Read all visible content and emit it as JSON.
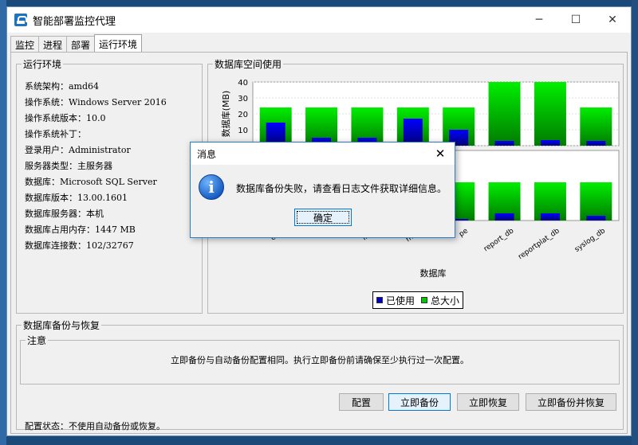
{
  "window": {
    "title": "智能部署监控代理",
    "controls": {
      "minimize": "─",
      "maximize": "☐",
      "close": "✕"
    }
  },
  "tabs": [
    {
      "label": "监控",
      "active": false
    },
    {
      "label": "进程",
      "active": false
    },
    {
      "label": "部署",
      "active": false
    },
    {
      "label": "运行环境",
      "active": true
    }
  ],
  "env": {
    "title": "运行环境",
    "lines": [
      "系统架构：amd64",
      "操作系统：Windows Server 2016",
      "操作系统版本：10.0",
      "操作系统补丁：",
      "登录用户：Administrator",
      "服务器类型：主服务器",
      "数据库：Microsoft SQL Server",
      "数据库版本：13.00.1601",
      "数据库服务器：本机",
      "数据库占用内存：1447 MB",
      "数据库连接数：102/32767"
    ]
  },
  "db_panel": {
    "title": "数据库空间使用"
  },
  "chart_data": {
    "type": "bar",
    "xlabel": "数据库",
    "ylabel": "数据库(MB)",
    "ylim": [
      0,
      40
    ],
    "yticks": [
      "0",
      "10",
      "20",
      "30",
      "40"
    ],
    "categories_visible": [
      "conf",
      "ic",
      "inve",
      "moni",
      "pe",
      "report_db",
      "reportplat_db",
      "syslog_db"
    ],
    "series": [
      {
        "name": "已使用",
        "color": "#0000c8",
        "values": [
          14.5,
          5,
          5,
          17,
          10,
          3,
          3.5,
          3
        ]
      },
      {
        "name": "总大小",
        "color": "#00c800",
        "values": [
          24,
          24,
          24,
          24,
          24,
          40,
          40,
          24
        ]
      }
    ],
    "lower_panel": {
      "series": [
        {
          "name": "已使用",
          "values": [
            2,
            2,
            2,
            2,
            2,
            9,
            9,
            6
          ]
        },
        {
          "name": "总大小",
          "values": [
            60,
            60,
            60,
            60,
            60,
            60,
            60,
            60
          ]
        }
      ]
    },
    "legend": "bottom"
  },
  "backup": {
    "title": "数据库备份与恢复",
    "note_title": "注意",
    "note_text": "立即备份与自动备份配置相同。执行立即备份前请确保至少执行过一次配置。",
    "buttons": {
      "config": "配置",
      "backup_now": "立即备份",
      "restore_now": "立即恢复",
      "backup_restore": "立即备份并恢复"
    },
    "status": "配置状态：不使用自动备份或恢复。"
  },
  "dialog": {
    "title": "消息",
    "close": "✕",
    "message": "数据库备份失败，请查看日志文件获取详细信息。",
    "ok": "确定",
    "icon": "info-icon"
  },
  "colors": {
    "used": "#0000c8",
    "total": "#00c800",
    "accent": "#0078d7"
  }
}
